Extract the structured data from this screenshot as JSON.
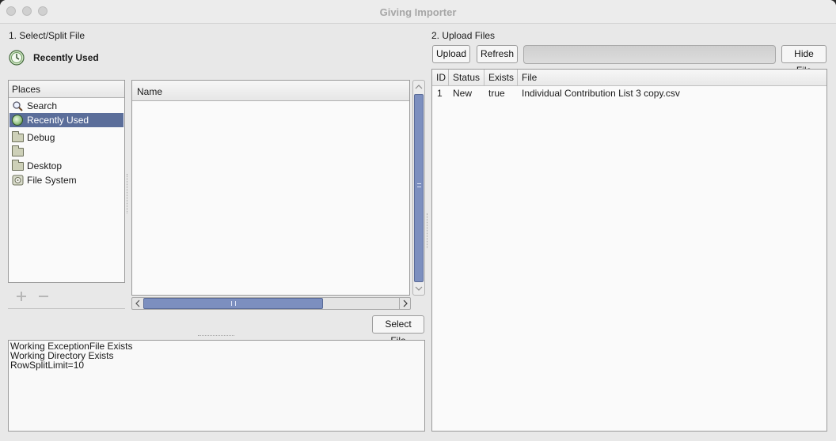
{
  "window": {
    "title": "Giving Importer"
  },
  "left": {
    "section_label": "1. Select/Split File",
    "location_label": "Recently Used",
    "places_header": "Places",
    "places": [
      {
        "label": "Search",
        "icon": "search-icon"
      },
      {
        "label": "Recently Used",
        "icon": "recent-icon",
        "selected": true
      },
      {
        "label": "Debug",
        "icon": "folder-icon"
      },
      {
        "label": "",
        "icon": "folder-icon"
      },
      {
        "label": "Desktop",
        "icon": "folder-icon"
      },
      {
        "label": "File System",
        "icon": "drive-icon"
      }
    ],
    "name_header": "Name",
    "select_file_label": "Select File",
    "status_lines": [
      "Working ExceptionFile Exists",
      "Working Directory Exists",
      "RowSplitLimit=10"
    ]
  },
  "right": {
    "section_label": "2. Upload Files",
    "upload_label": "Upload",
    "refresh_label": "Refresh",
    "progress": 0,
    "hide_file_label": "Hide File",
    "table": {
      "columns": [
        "ID",
        "Status",
        "Exists",
        "File"
      ],
      "rows": [
        [
          "1",
          "New",
          "true",
          "Individual Contribution List 3 copy.csv"
        ]
      ]
    }
  },
  "colors": {
    "selection": "#5b6e9a",
    "scroll_thumb": "#7c8fbf"
  }
}
